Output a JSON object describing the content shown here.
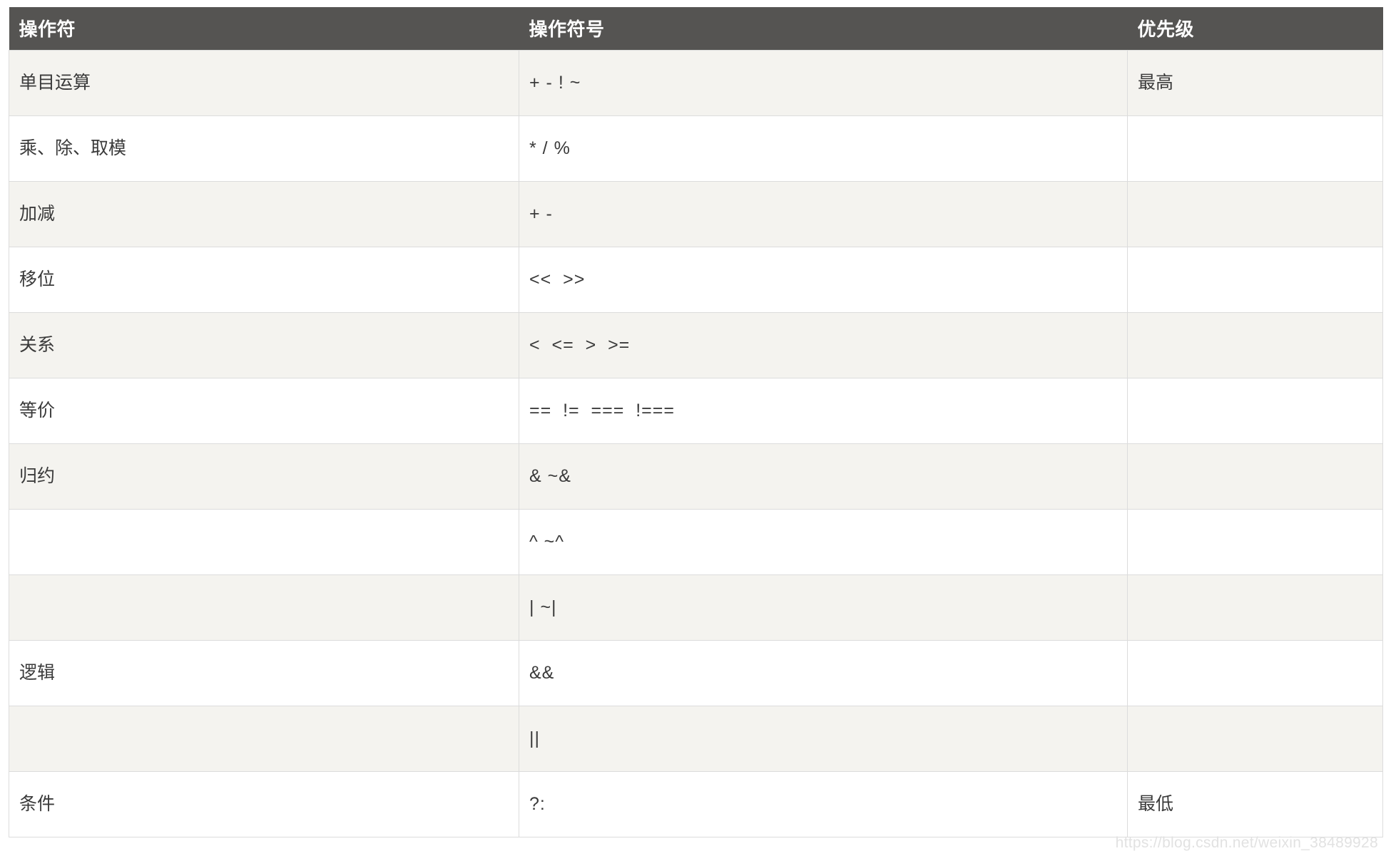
{
  "table": {
    "headers": [
      "操作符",
      "操作符号",
      "优先级"
    ],
    "rows": [
      {
        "name": "单目运算",
        "symbols": "+ - ! ~",
        "priority": "最高"
      },
      {
        "name": "乘、除、取模",
        "symbols": "* / %",
        "priority": ""
      },
      {
        "name": "加减",
        "symbols": "+ -",
        "priority": ""
      },
      {
        "name": "移位",
        "symbols": "<<  >>",
        "priority": ""
      },
      {
        "name": "关系",
        "symbols": "<  <=  >  >=",
        "priority": ""
      },
      {
        "name": "等价",
        "symbols": "==  !=  ===  !===",
        "priority": ""
      },
      {
        "name": "归约",
        "symbols": "& ~&",
        "priority": ""
      },
      {
        "name": "",
        "symbols": "^ ~^",
        "priority": ""
      },
      {
        "name": "",
        "symbols": "| ~|",
        "priority": ""
      },
      {
        "name": "逻辑",
        "symbols": "&&",
        "priority": ""
      },
      {
        "name": "",
        "symbols": "||",
        "priority": ""
      },
      {
        "name": "条件",
        "symbols": "?:",
        "priority": "最低"
      }
    ]
  },
  "watermark": {
    "text": "https://blog.csdn.net/weixin_38489928"
  },
  "colors": {
    "header_background": "#555452",
    "header_text": "#ffffff",
    "row_odd_background": "#f4f3ef",
    "row_even_background": "#ffffff",
    "border": "#dcdcdc",
    "body_text": "#3a3a3a",
    "watermark_text": "#e2e2e2"
  }
}
